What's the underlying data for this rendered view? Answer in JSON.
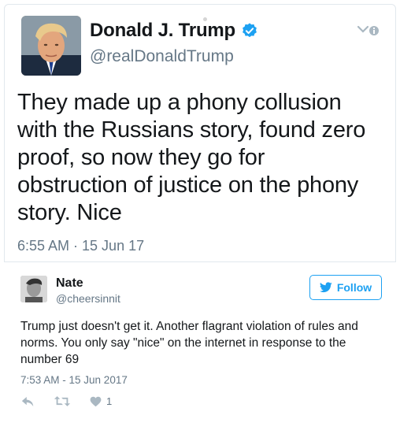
{
  "tweet": {
    "author_name": "Donald J. Trump",
    "author_handle": "@realDonaldTrump",
    "text": "They made up a phony collusion with the Russians story, found zero proof, so now they go for obstruction of justice on the phony story. Nice",
    "timestamp": "6:55 AM · 15 Jun 17",
    "verified": true,
    "icons": {
      "verified": "verified-badge-icon",
      "menu": "chevron-down-icon"
    }
  },
  "reply": {
    "author_name": "Nate",
    "author_handle": "@cheersinnit",
    "follow_label": "Follow",
    "text": "Trump just doesn't get it. Another flagrant violation of rules and norms. You only say \"nice\" on the internet in response to the number 69",
    "timestamp": "7:53 AM - 15 Jun 2017",
    "like_count": "1",
    "icons": {
      "reply": "reply-icon",
      "retweet": "retweet-icon",
      "like": "heart-icon",
      "bird": "twitter-bird-icon"
    }
  },
  "colors": {
    "accent": "#1da1f2",
    "text": "#14171a",
    "muted": "#657786",
    "action_gray": "#aab8c2"
  }
}
